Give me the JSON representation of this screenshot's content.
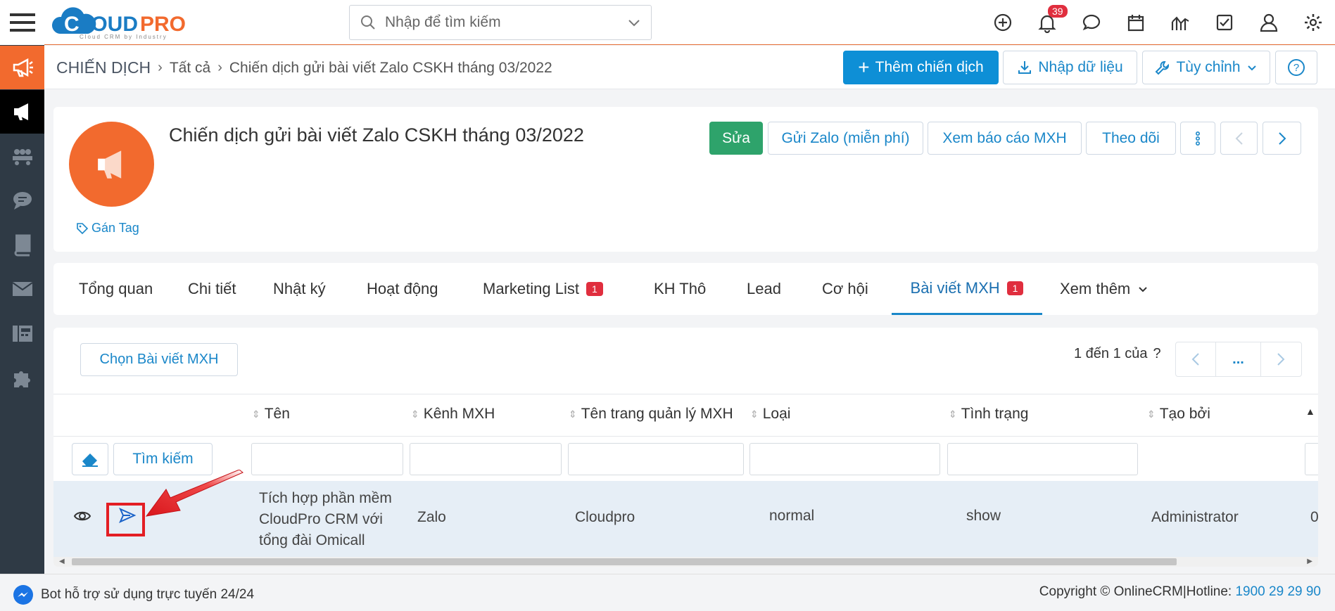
{
  "app": {
    "logo_text": "CLOUDPRO",
    "logo_tagline": "Cloud CRM by Industry"
  },
  "search": {
    "placeholder": "Nhập để tìm kiếm"
  },
  "notifications": {
    "count": "39"
  },
  "breadcrumb": {
    "root": "CHIẾN DỊCH",
    "level1": "Tất cả",
    "current": "Chiến dịch gửi bài viết Zalo CSKH tháng 03/2022"
  },
  "toolbar": {
    "add_label": "Thêm chiến dịch",
    "import_label": "Nhập dữ liệu",
    "customize_label": "Tùy chỉnh"
  },
  "record": {
    "title": "Chiến dịch gửi bài viết Zalo CSKH tháng 03/2022",
    "tag_label": "Gán Tag",
    "actions": {
      "edit": "Sửa",
      "send_zalo": "Gửi Zalo (miễn phí)",
      "report": "Xem báo cáo MXH",
      "follow": "Theo dõi"
    }
  },
  "tabs": [
    {
      "label": "Tổng quan"
    },
    {
      "label": "Chi tiết"
    },
    {
      "label": "Nhật ký"
    },
    {
      "label": "Hoạt động"
    },
    {
      "label": "Marketing List",
      "count": "1"
    },
    {
      "label": "KH Thô"
    },
    {
      "label": "Lead"
    },
    {
      "label": "Cơ hội"
    },
    {
      "label": "Bài viết MXH",
      "count": "1"
    },
    {
      "label": "Xem thêm"
    }
  ],
  "list": {
    "select_button": "Chọn Bài viết MXH",
    "pagination": "1 đến 1 của",
    "pagination_help": "?",
    "more": "...",
    "search_button": "Tìm kiếm",
    "columns": [
      "Tên",
      "Kênh MXH",
      "Tên trang quản lý MXH",
      "Loại",
      "Tình trạng",
      "Tạo bởi"
    ],
    "rows": [
      {
        "name_line1": "Tích hợp phần mềm",
        "name_line2": "CloudPro CRM với",
        "name_line3": "tổng đài Omicall",
        "channel": "Zalo",
        "page": "Cloudpro",
        "type": "normal",
        "status": "show",
        "created_by": "Administrator",
        "overflow": "0"
      }
    ]
  },
  "footer": {
    "bot_text": "Bot hỗ trợ sử dụng trực tuyến 24/24",
    "copyright": "Copyright © OnlineCRM|Hotline: ",
    "hotline": "1900 29 29 90"
  },
  "colors": {
    "brand_orange": "#f26a2e",
    "primary_blue": "#0e8fd6",
    "edit_green": "#2ea36b",
    "badge_red": "#e02e3e",
    "sidebar_dark": "#2f3a45",
    "annotation_red": "#e31e24"
  }
}
